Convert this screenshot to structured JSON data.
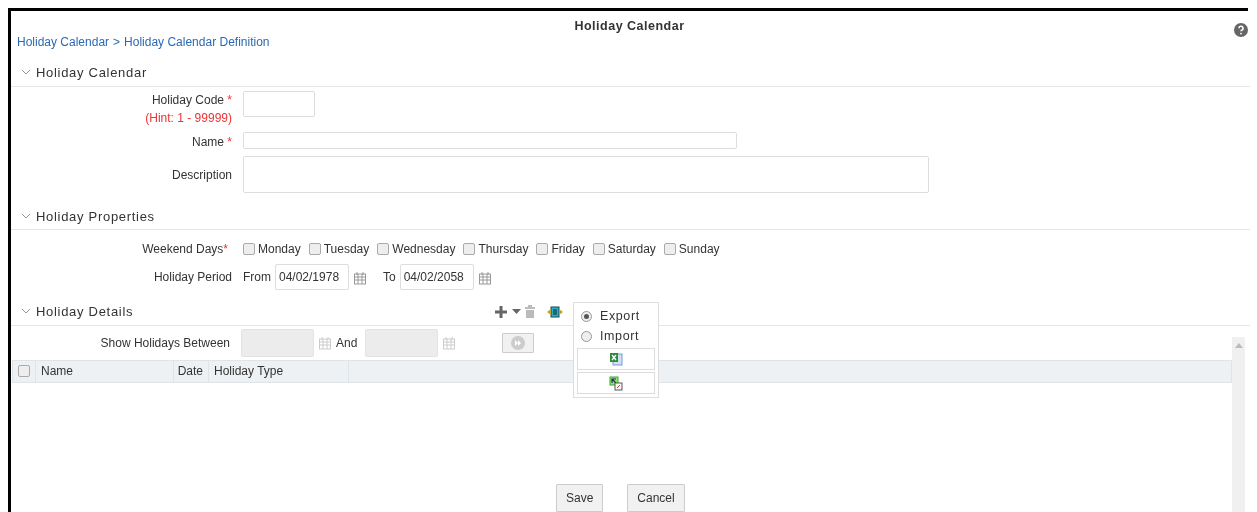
{
  "window": {
    "title": "Holiday Calendar"
  },
  "breadcrumb": {
    "items": [
      "Holiday Calendar",
      "Holiday Calendar Definition"
    ],
    "separator": ">"
  },
  "required_mark": "*",
  "calendar_section": {
    "title": "Holiday Calendar",
    "expanded": true,
    "fields": [
      {
        "label": "Holiday Code",
        "required": true,
        "hint": "(Hint: 1 - 99999)",
        "kind": "short"
      },
      {
        "label": "Name",
        "required": true,
        "kind": "line"
      },
      {
        "label": "Description",
        "required": false,
        "kind": "area"
      }
    ]
  },
  "properties_section": {
    "title": "Holiday Properties",
    "expanded": true,
    "weekend": {
      "label": "Weekend Days",
      "required": true,
      "days": [
        {
          "label": "Monday",
          "checked": false
        },
        {
          "label": "Tuesday",
          "checked": false
        },
        {
          "label": "Wednesday",
          "checked": false
        },
        {
          "label": "Thursday",
          "checked": false
        },
        {
          "label": "Friday",
          "checked": false
        },
        {
          "label": "Saturday",
          "checked": false
        },
        {
          "label": "Sunday",
          "checked": false
        }
      ]
    },
    "period": {
      "label": "Holiday Period",
      "from_label": "From",
      "from_value": "04/02/1978",
      "to_label": "To",
      "to_value": "04/02/2058"
    }
  },
  "details_section": {
    "title": "Holiday Details",
    "expanded": true,
    "filter": {
      "label": "Show Holidays Between",
      "and_label": "And"
    },
    "table": {
      "all_checked": false,
      "columns": [
        "Name",
        "Date",
        "Holiday Type"
      ]
    },
    "menu": {
      "options": [
        {
          "label": "Export",
          "selected": true
        },
        {
          "label": "Import",
          "selected": false
        }
      ]
    }
  },
  "buttons": [
    "Save",
    "Cancel"
  ]
}
